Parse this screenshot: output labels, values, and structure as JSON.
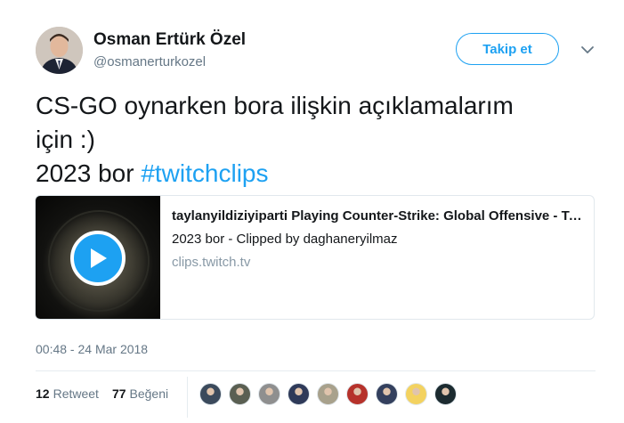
{
  "tweet": {
    "author": {
      "name": "Osman Ertürk Özel",
      "handle": "@osmanerturkozel"
    },
    "follow_label": "Takip et",
    "text_line1": "CS-GO oynarken bora ilişkin açıklamalarım",
    "text_line2": "için :)",
    "text_line3_prefix": "2023 bor ",
    "hashtag": "#twitchclips",
    "card": {
      "title": "taylanyildiziyiparti Playing Counter-Strike: Global Offensive - Twitch Clips",
      "description": "2023 bor - Clipped by daghaneryilmaz",
      "domain": "clips.twitch.tv"
    },
    "timestamp": "00:48 - 24 Mar 2018",
    "stats": {
      "retweet_count": "12",
      "retweet_label": "Retweet",
      "like_count": "77",
      "like_label": "Beğeni"
    },
    "likers": [
      {
        "color": "#3b4a5c"
      },
      {
        "color": "#5a5f52"
      },
      {
        "color": "#8f8f8f"
      },
      {
        "color": "#2f3a59"
      },
      {
        "color": "#a8a18c"
      },
      {
        "color": "#b6322b"
      },
      {
        "color": "#34405e"
      },
      {
        "color": "#f3d260"
      },
      {
        "color": "#1c2b30"
      }
    ]
  },
  "colors": {
    "accent": "#1da1f2",
    "secondary_text": "#657786",
    "border": "#e1e8ed"
  }
}
